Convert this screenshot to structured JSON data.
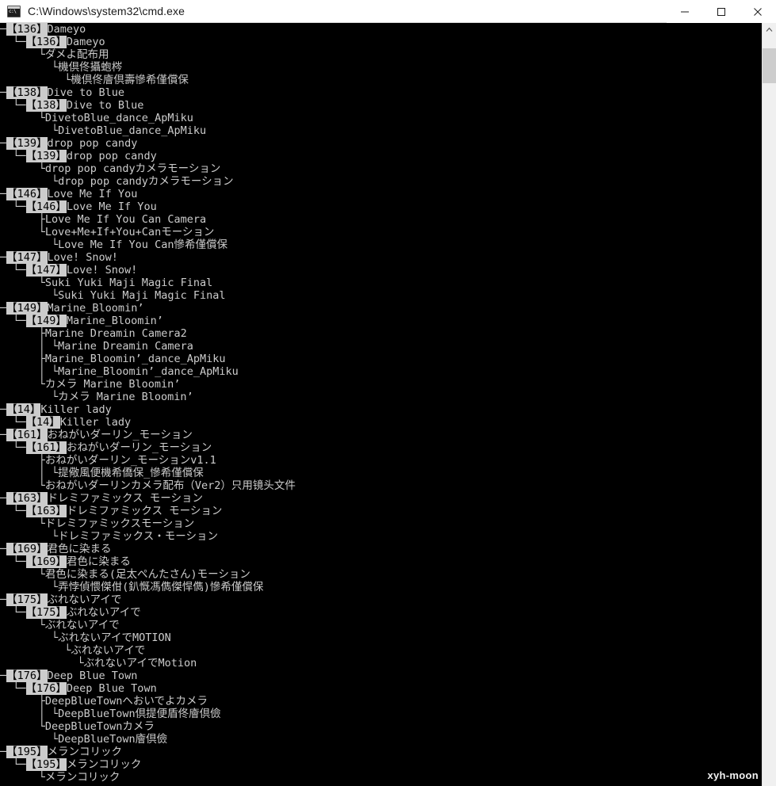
{
  "window": {
    "title": "C:\\Windows\\system32\\cmd.exe",
    "icon": "cmd-icon",
    "minimize_label": "—",
    "maximize_label": "□",
    "close_label": "✕",
    "background_color": "#000000",
    "foreground_color": "#cccccc",
    "titlebar_color": "#ffffff"
  },
  "scrollbar": {
    "up_arrow": "˄",
    "down_arrow": "˅",
    "thumb_position_percent": 2
  },
  "watermark": {
    "text": "xyh-moon"
  },
  "console": {
    "lines": [
      "─【136】Dameyo",
      "  └─【136】Dameyo",
      "      └ダメよ配布用",
      "        └機倶佟攝蚫梣",
      "          └機倶佟廥倶壽慘希僅償保",
      "─【138】Dive to Blue",
      "  └─【138】Dive to Blue",
      "      └DivetoBlue_dance_ApMiku",
      "        └DivetoBlue_dance_ApMiku",
      "─【139】drop pop candy",
      "  └─【139】drop pop candy",
      "      └drop pop candyカメラモーション",
      "        └drop pop candyカメラモーション",
      "─【146】Love Me If You",
      "  └─【146】Love Me If You",
      "      ├Love Me If You Can Camera",
      "      └Love+Me+If+You+Canモーション",
      "        └Love Me If You Can慘希僅償保",
      "─【147】Love! Snow!",
      "  └─【147】Love! Snow!",
      "      └Suki Yuki Maji Magic Final",
      "        └Suki Yuki Maji Magic Final",
      "─【149】Marine_Bloomin’",
      "  └─【149】Marine_Bloomin’",
      "      ├Marine Dreamin Camera2",
      "      │ └Marine Dreamin Camera",
      "      ├Marine_Bloomin’_dance_ApMiku",
      "      │ └Marine_Bloomin’_dance_ApMiku",
      "      └カメラ Marine Bloomin’",
      "        └カメラ Marine Bloomin’",
      "─【14】Killer lady",
      "  └─【14】Killer lady",
      "─【161】おねがいダーリン_モーション",
      "  └─【161】おねがいダーリン_モーション",
      "      ├おねがいダーリン_モーションv1.1",
      "      │ └提儆風便機希僑保_慘希僅償保",
      "      └おねがいダーリンカメラ配布（Ver2）只用镜头文件",
      "─【163】ドレミファミックス モーション",
      "  └─【163】ドレミファミックス モーション",
      "      └ドレミファミックスモーション",
      "        └ドレミファミックス・モーション",
      "─【169】君色に染まる",
      "  └─【169】君色に染まる",
      "      └君色に染まる(足太ぺんたさん)モーション",
      "        └弄悖偵愄傑佄(釟慨馮儁傑悍儁)慘希僅償保",
      "─【175】ぶれないアイで",
      "  └─【175】ぶれないアイで",
      "      └ぶれないアイで",
      "        └ぶれないアイでMOTION",
      "          └ぶれないアイで",
      "            └ぶれないアイでMotion",
      "─【176】Deep Blue Town",
      "  └─【176】Deep Blue Town",
      "      ├DeepBlueTownへおいでよカメラ",
      "      │ └DeepBlueTown倶提便盾佟廥倶儉",
      "      └DeepBlueTownカメラ",
      "        └DeepBlueTown廥倶儉",
      "─【195】メランコリック",
      "  └─【195】メランコリック",
      "      └メランコリック"
    ],
    "highlight_tokens": [
      "【136】",
      "【138】",
      "【139】",
      "【146】",
      "【147】",
      "【149】",
      "【14】",
      "【161】",
      "【163】",
      "【169】",
      "【175】",
      "【176】",
      "【195】"
    ]
  }
}
